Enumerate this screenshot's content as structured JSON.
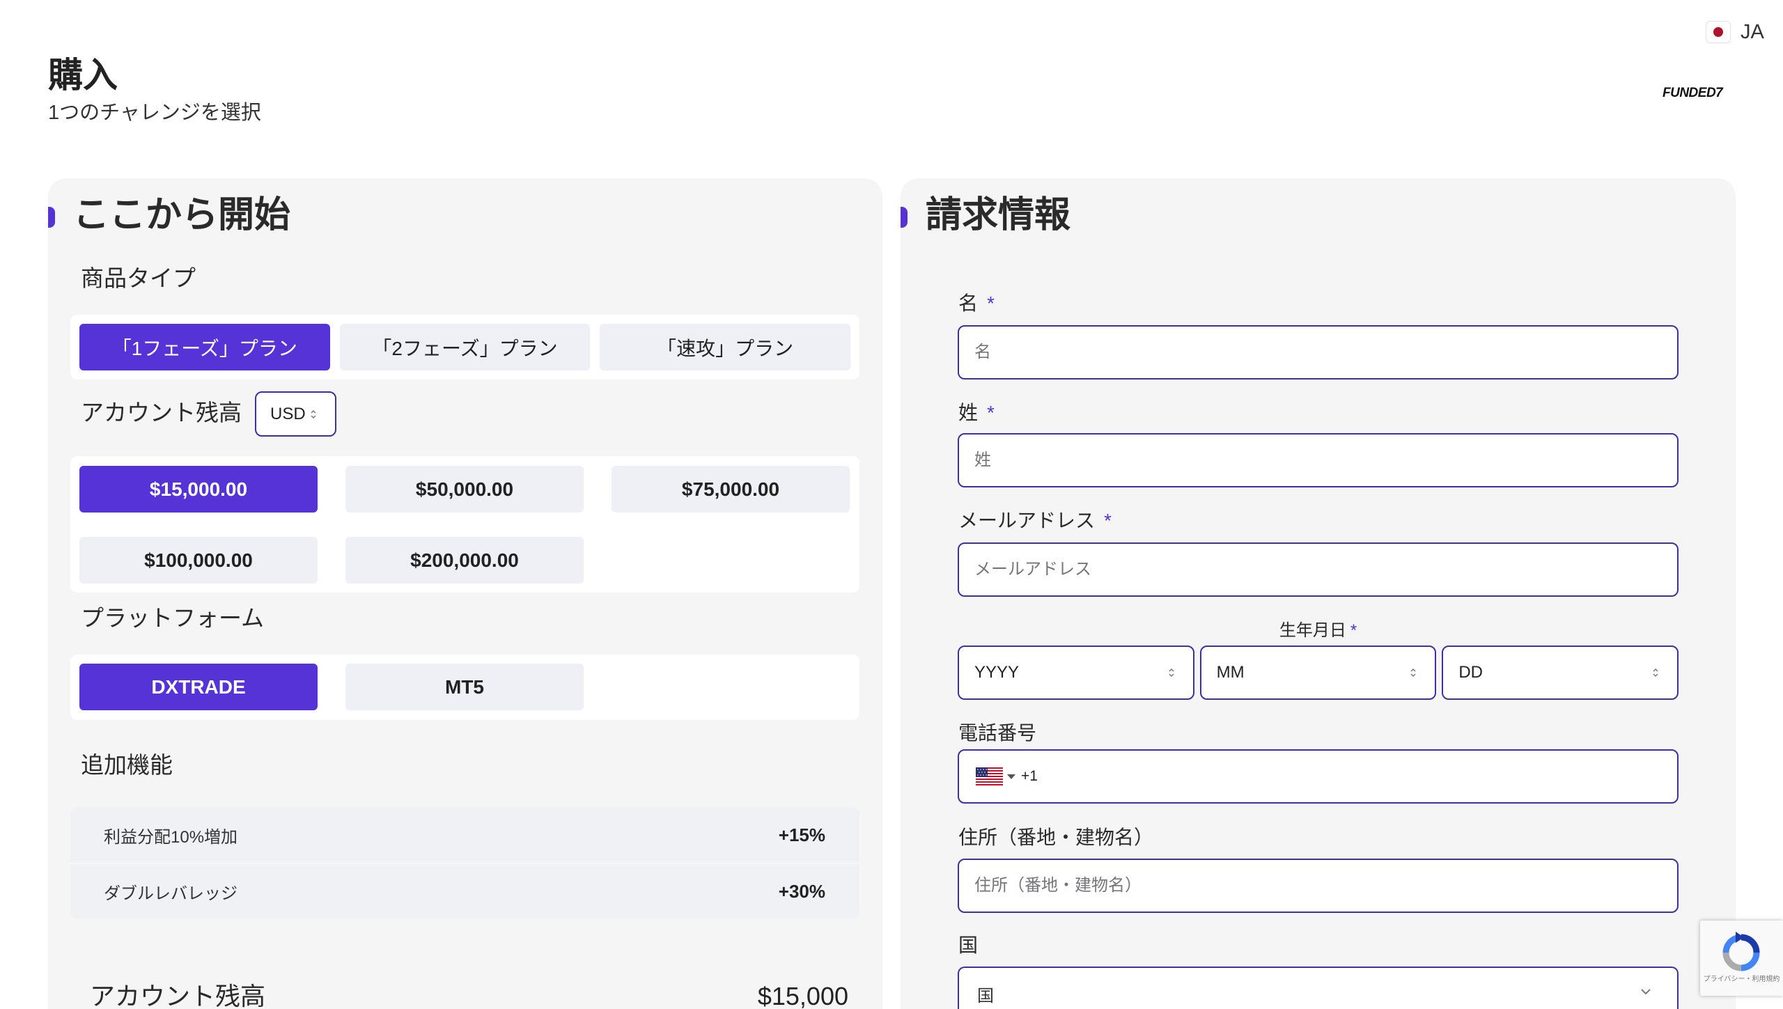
{
  "header": {
    "title": "購入",
    "subtitle": "1つのチャレンジを選択"
  },
  "logo": {
    "text": "FUNDED7"
  },
  "language": {
    "code": "JA",
    "flag_icon": "japan-flag-icon"
  },
  "left": {
    "heading": "ここから開始",
    "product_type": {
      "label": "商品タイプ",
      "options": [
        "「1フェーズ」プラン",
        "「2フェーズ」プラン",
        "「速攻」プラン"
      ],
      "selected": 0
    },
    "balance": {
      "label": "アカウント残高",
      "currency": "USD",
      "options": [
        "$15,000.00",
        "$50,000.00",
        "$75,000.00",
        "$100,000.00",
        "$200,000.00"
      ],
      "selected": 0
    },
    "platform": {
      "label": "プラットフォーム",
      "options": [
        "DXTRADE",
        "MT5"
      ],
      "selected": 0
    },
    "addons": {
      "label": "追加機能",
      "items": [
        {
          "name": "利益分配10%増加",
          "value": "+15%"
        },
        {
          "name": "ダブルレバレッジ",
          "value": "+30%"
        }
      ]
    },
    "summary": {
      "label": "アカウント残高",
      "value": "$15,000"
    }
  },
  "right": {
    "heading": "請求情報",
    "first_name": {
      "label": "名",
      "required_mark": "*",
      "placeholder": "名"
    },
    "last_name": {
      "label": "姓",
      "required_mark": "*",
      "placeholder": "姓"
    },
    "email": {
      "label": "メールアドレス",
      "required_mark": "*",
      "placeholder": "メールアドレス"
    },
    "birthdate": {
      "label": "生年月日",
      "required_mark": "*",
      "year": "YYYY",
      "month": "MM",
      "day": "DD"
    },
    "phone": {
      "label": "電話番号",
      "dial_code": "+1",
      "flag_icon": "us-flag-icon"
    },
    "address": {
      "label": "住所（番地・建物名）",
      "placeholder": "住所（番地・建物名）"
    },
    "country": {
      "label": "国",
      "placeholder": "国"
    }
  },
  "recaptcha": {
    "text": "プライバシー・利用規約"
  },
  "colors": {
    "accent": "#5533d6",
    "input_border": "#3d30a6",
    "panel_bg": "#f5f5f6",
    "option_bg": "#eef0f5"
  }
}
